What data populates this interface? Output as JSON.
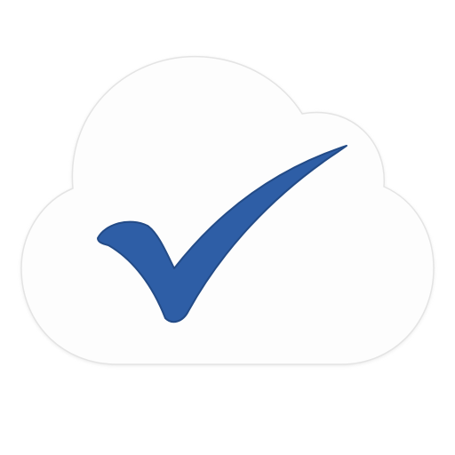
{
  "icon": {
    "name": "cloud-checkmark-icon",
    "cloud_fill": "#fdfdfd",
    "cloud_outline": "#e4e4e4",
    "check_fill": "#2e5ea6",
    "check_edge": "#234b87"
  }
}
